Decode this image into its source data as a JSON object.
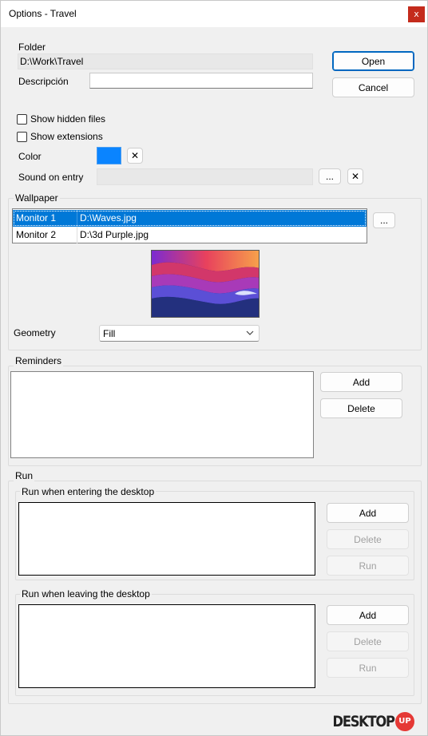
{
  "window": {
    "title": "Options - Travel",
    "close_glyph": "x"
  },
  "folder": {
    "label": "Folder",
    "value": "D:\\Work\\Travel"
  },
  "description": {
    "label": "Descripción",
    "value": ""
  },
  "buttons": {
    "open": "Open",
    "cancel": "Cancel"
  },
  "options": {
    "show_hidden": "Show hidden files",
    "show_extensions": "Show extensions"
  },
  "color": {
    "label": "Color",
    "swatch": "#0a84ff",
    "clear_glyph": "✕"
  },
  "sound": {
    "label": "Sound on entry",
    "value": "",
    "browse": "...",
    "clear_glyph": "✕"
  },
  "wallpaper": {
    "title": "Wallpaper",
    "browse": "...",
    "rows": [
      {
        "monitor": "Monitor 1",
        "file": "D:\\Waves.jpg"
      },
      {
        "monitor": "Monitor 2",
        "file": "D:\\3d Purple.jpg"
      }
    ],
    "geometry_label": "Geometry",
    "geometry_value": "Fill"
  },
  "reminders": {
    "title": "Reminders",
    "add": "Add",
    "delete": "Delete"
  },
  "run": {
    "title": "Run",
    "entering": {
      "title": "Run when entering the desktop",
      "add": "Add",
      "delete": "Delete",
      "run": "Run"
    },
    "leaving": {
      "title": "Run when leaving the desktop",
      "add": "Add",
      "delete": "Delete",
      "run": "Run"
    }
  },
  "branding": {
    "logo_text": "DESKTOP",
    "logo_badge": "UP"
  }
}
